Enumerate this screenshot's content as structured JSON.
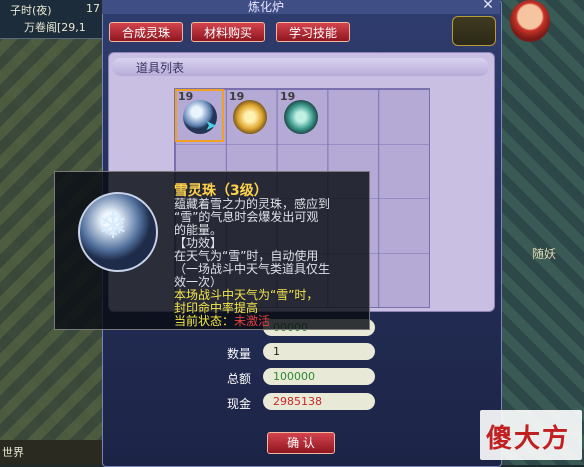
{
  "hud": {
    "time": "子时(夜)",
    "time_extra": "17",
    "location": "万卷阁[29,1",
    "world_label": "世界",
    "side_label": "随妖"
  },
  "window": {
    "title": "炼化炉",
    "tabs": [
      "合成灵珠",
      "材料购买",
      "学习技能"
    ],
    "panel_header": "道具列表"
  },
  "items": [
    {
      "name": "雪灵珠",
      "count": "19",
      "icon": "snowflake-orb-icon"
    },
    {
      "name": "",
      "count": "19",
      "icon": "golden-swirl-orb-icon"
    },
    {
      "name": "",
      "count": "19",
      "icon": "water-drop-orb-icon"
    }
  ],
  "tooltip": {
    "title": "雪灵珠（3级）",
    "lines": [
      "蕴藏着雪之力的灵珠，感应到",
      "“雪”的气息时会爆发出可观",
      "的能量。",
      "【功效】",
      "在天气为“雪”时，自动使用",
      "（一场战斗中天气类道具仅生",
      "效一次）"
    ],
    "effect_lines": [
      "本场战斗中天气为“雪”时，",
      "封印命中率提高"
    ],
    "status_label": "当前状态：",
    "status_value": "未激活"
  },
  "form": {
    "price_label": "",
    "price_value": "00000",
    "quantity_label": "数量",
    "quantity_value": "1",
    "total_label": "总额",
    "total_value": "100000",
    "cash_label": "现金",
    "cash_value": "2985138",
    "confirm_label": "确 认"
  },
  "watermark": "傻大方",
  "colors": {
    "tab_red": "#b52a33",
    "tooltip_title": "#ffd34a",
    "tooltip_effect": "#f5e84a",
    "status_inactive": "#e04040",
    "total_green": "#2e8a2e",
    "cash_red": "#c8282a"
  }
}
